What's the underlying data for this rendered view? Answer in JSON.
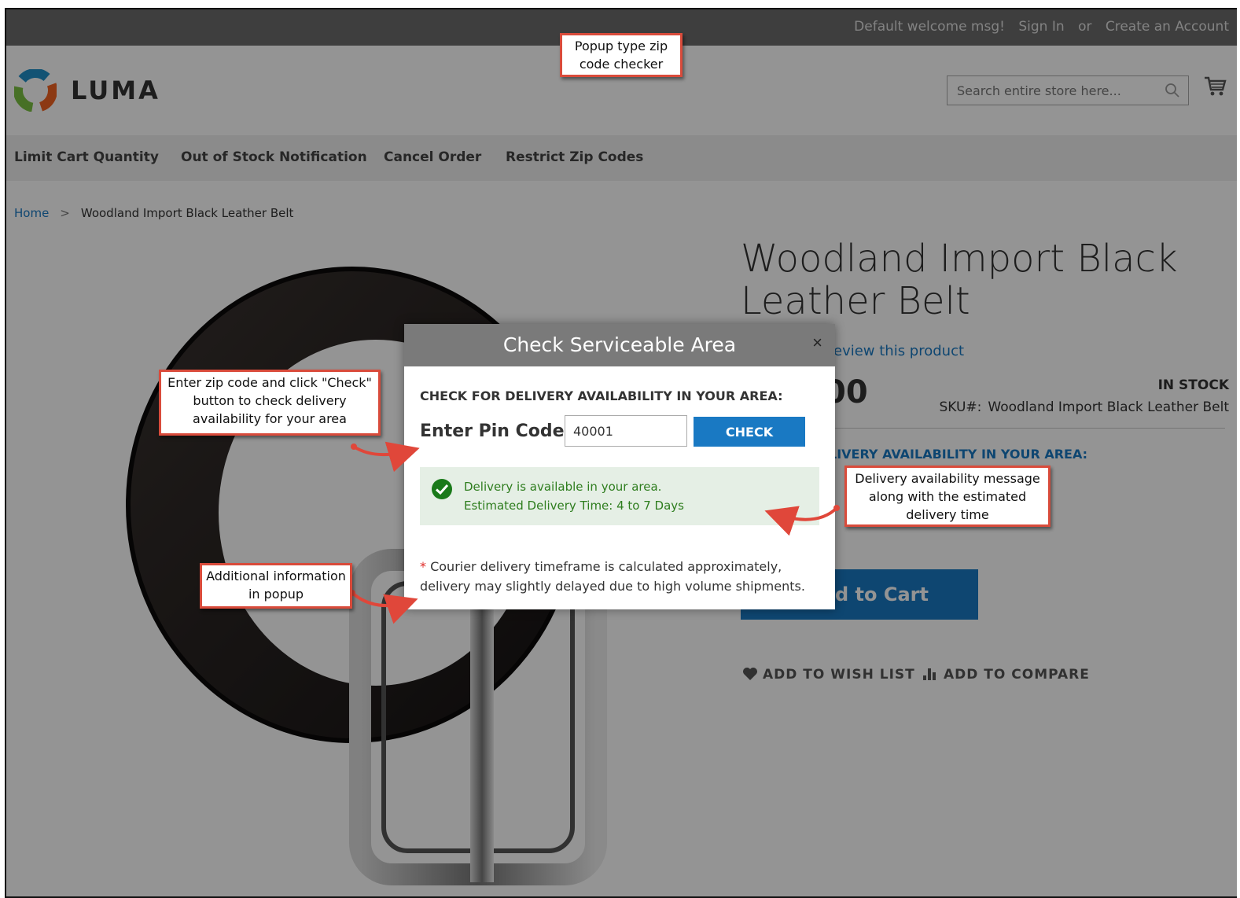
{
  "topbar": {
    "welcome": "Default welcome msg!",
    "sign_in": "Sign In",
    "or": "or",
    "create_account": "Create an Account"
  },
  "header": {
    "logo_text": "LUMA",
    "search_placeholder": "Search entire store here..."
  },
  "nav": {
    "items": [
      "Limit Cart Quantity",
      "Out of Stock Notification",
      "Cancel Order",
      "Restrict Zip Codes"
    ]
  },
  "breadcrumb": {
    "home": "Home",
    "sep": ">",
    "current": "Woodland Import Black Leather Belt"
  },
  "product": {
    "title": "Woodland Import Black Leather Belt",
    "review_link": "eview this product",
    "price_partial": "00",
    "stock": "IN STOCK",
    "sku_label": "SKU#:",
    "sku_value": "Woodland Import Black Leather Belt",
    "availability_label_partial": "LIVERY AVAILABILITY IN YOUR AREA:",
    "add_to_cart_partial": "d to Cart",
    "wishlist": "ADD TO WISH LIST",
    "compare": "ADD TO COMPARE"
  },
  "modal": {
    "title": "Check Serviceable Area",
    "close": "×",
    "heading": "CHECK FOR DELIVERY AVAILABILITY IN YOUR AREA:",
    "pin_label": "Enter Pin Code",
    "required": "*",
    "pin_value": "40001",
    "check_button": "CHECK",
    "msg_line1": "Delivery is available in your area.",
    "msg_line2": "Estimated Delivery Time: 4 to 7 Days",
    "note_star": "*",
    "note": " Courier delivery timeframe is calculated approximately, delivery may slightly delayed due to high volume shipments."
  },
  "callouts": {
    "popup_type": "Popup type zip code checker",
    "enter_zip": "Enter zip code and click \"Check\" button to check delivery availability for your area",
    "delivery_msg": "Delivery availability message along with the estimated delivery time",
    "additional": "Additional information in popup"
  },
  "colors": {
    "accent": "#1979c3",
    "callout_border": "#d94b3b",
    "success_bg": "#e5efe5",
    "success_text": "#2e7d1e"
  }
}
